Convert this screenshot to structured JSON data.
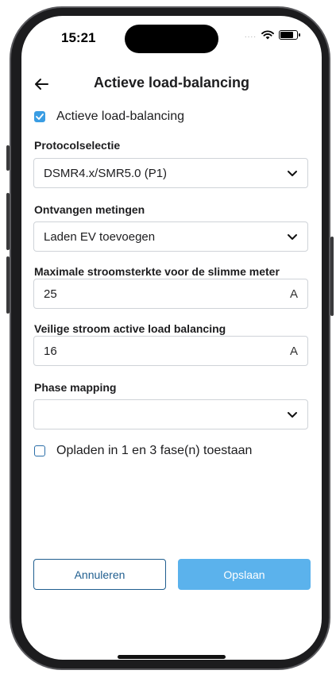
{
  "status_bar": {
    "time": "15:21",
    "signal_dots": "....",
    "wifi_icon": "wifi-icon",
    "battery_icon": "battery-icon"
  },
  "header": {
    "title": "Actieve load-balancing",
    "back_icon": "arrow-left-icon"
  },
  "active_toggle": {
    "label": "Actieve load-balancing",
    "checked": true
  },
  "protocol": {
    "label": "Protocolselectie",
    "value": "DSMR4.x/SMR5.0 (P1)"
  },
  "received": {
    "label": "Ontvangen metingen",
    "value": "Laden EV toevoegen"
  },
  "max_current": {
    "label": "Maximale stroomsterkte voor de slimme meter",
    "value": "25",
    "unit": "A"
  },
  "safe_current": {
    "label": "Veilige stroom active load balancing",
    "value": "16",
    "unit": "A"
  },
  "phase_mapping": {
    "label": "Phase mapping",
    "value": ""
  },
  "phase_toggle": {
    "label": "Opladen in 1 en 3 fase(n) toestaan",
    "checked": false
  },
  "buttons": {
    "cancel": "Annuleren",
    "save": "Opslaan"
  },
  "colors": {
    "accent": "#3a9de3",
    "save_bg": "#5bb2ec",
    "cancel_border": "#1f5e8f"
  }
}
